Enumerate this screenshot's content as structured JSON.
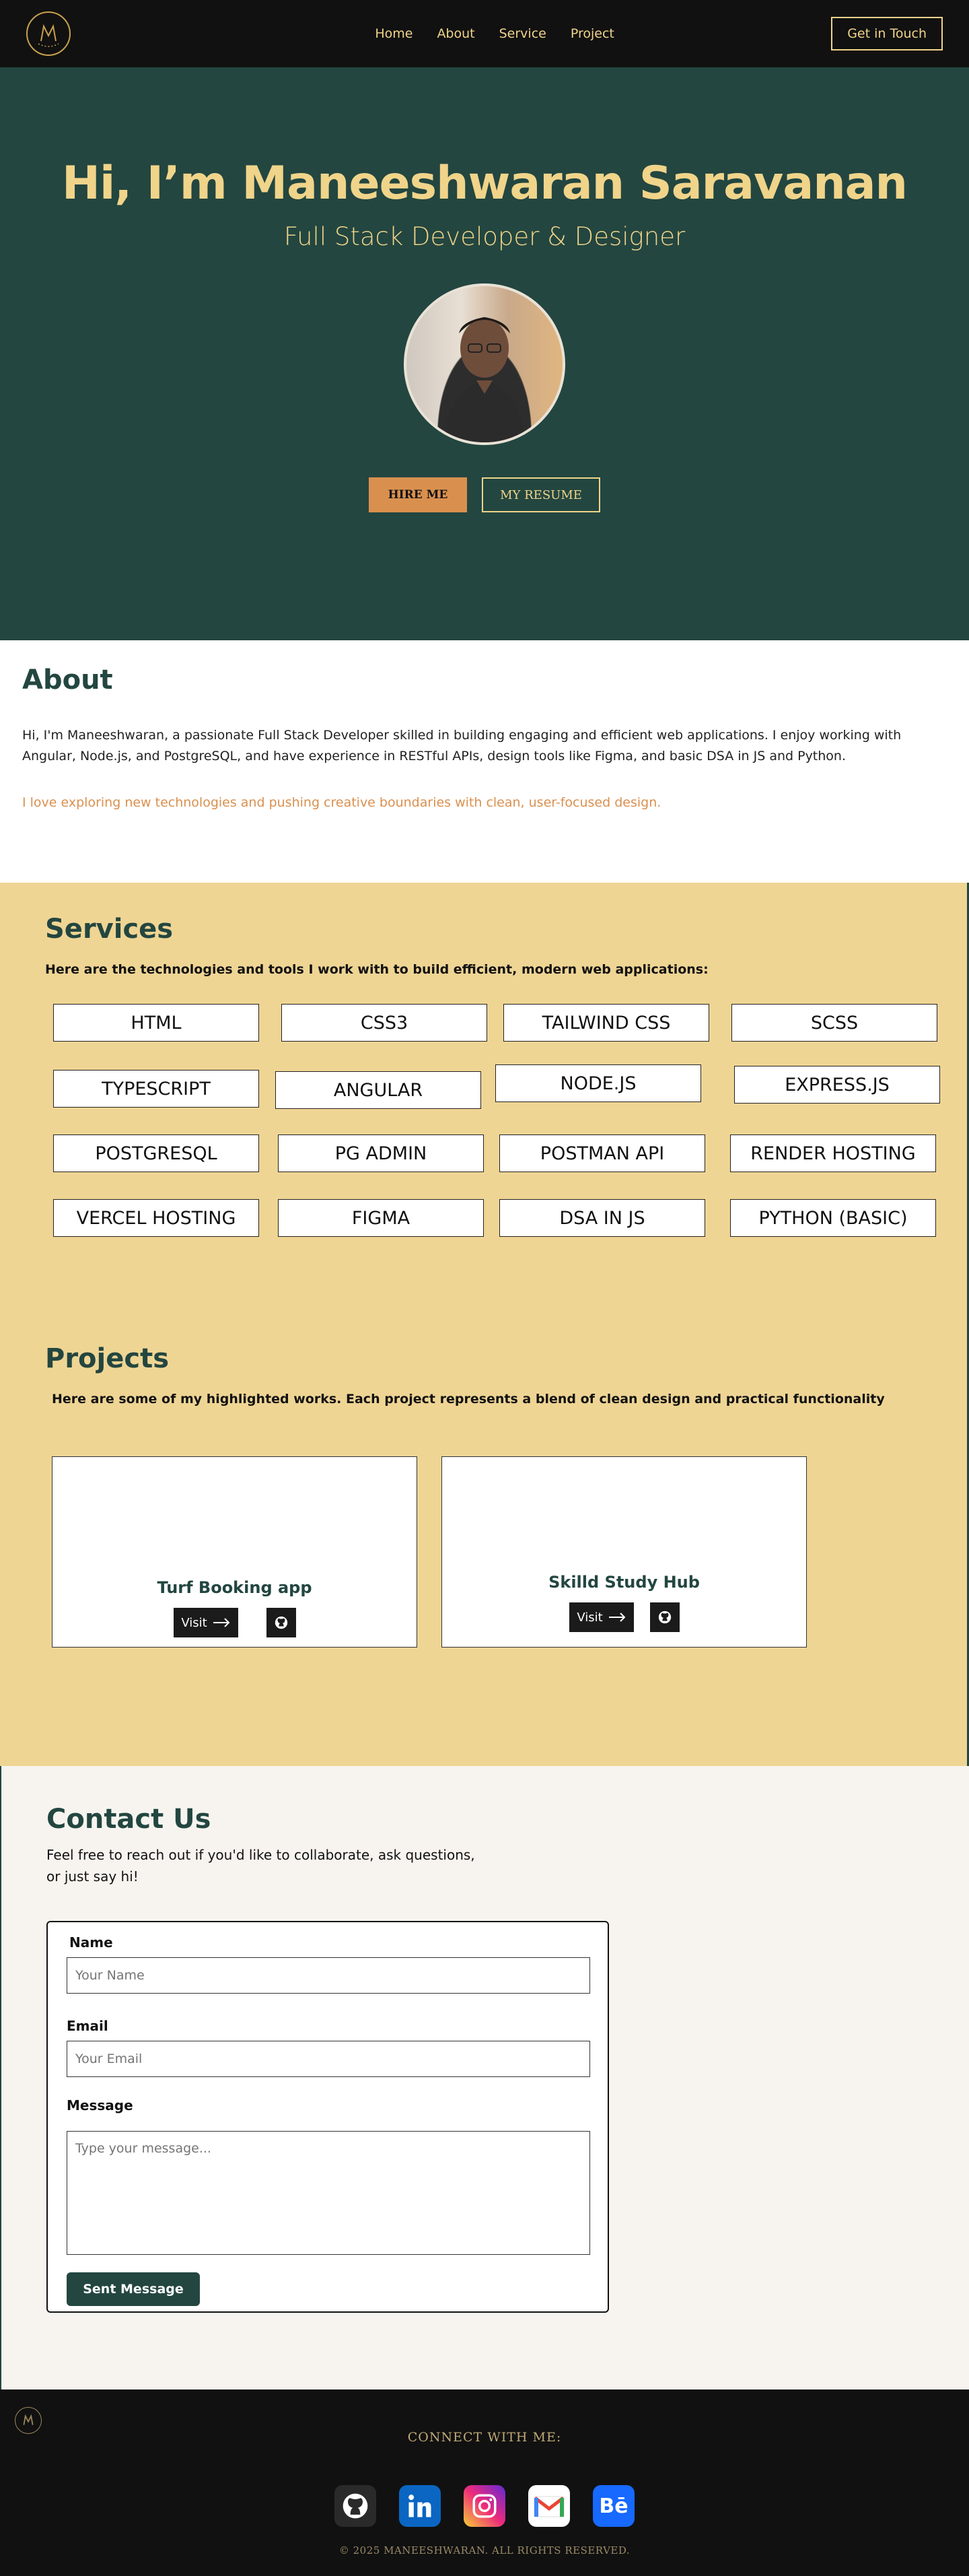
{
  "nav": {
    "links": [
      "Home",
      "About",
      "Service",
      "Project"
    ],
    "cta": "Get in Touch"
  },
  "hero": {
    "title": "Hi, I’m Maneeshwaran Saravanan",
    "subtitle": "Full Stack Developer & Designer",
    "hire_label": "HIRE ME",
    "resume_label": "MY RESUME"
  },
  "about": {
    "heading": "About",
    "body": "Hi, I'm Maneeshwaran, a passionate Full Stack Developer skilled in building engaging and efficient web applications. I enjoy working with Angular, Node.js, and PostgreSQL, and have experience in RESTful APIs, design tools like Figma, and basic DSA in JS and Python.",
    "tagline": "I love exploring new technologies and pushing creative boundaries with clean, user-focused design."
  },
  "services": {
    "heading": "Services",
    "intro": "Here are the technologies and tools I work with to build efficient, modern web applications:",
    "skills": [
      "HTML",
      "CSS3",
      "TAILWIND CSS",
      "SCSS",
      "TYPESCRIPT",
      "ANGULAR",
      "NODE.JS",
      "EXPRESS.JS",
      "POSTGRESQL",
      "PG ADMIN",
      "POSTMAN API",
      "RENDER HOSTING",
      "VERCEL HOSTING",
      "FIGMA",
      "DSA IN JS",
      "PYTHON (BASIC)"
    ]
  },
  "projects": {
    "heading": "Projects",
    "intro": "Here are some of my highlighted works. Each project represents a blend of clean design and practical functionality",
    "items": [
      {
        "title": "Turf Booking app",
        "visit": "Visit"
      },
      {
        "title": "Skilld Study Hub",
        "visit": "Visit"
      }
    ]
  },
  "contact": {
    "heading": "Contact Us",
    "lead": "Feel free to reach out if you'd like to collaborate, ask questions, or just say hi!",
    "name_label": "Name",
    "name_placeholder": "Your Name",
    "email_label": "Email",
    "email_placeholder": "Your Email",
    "message_label": "Message",
    "message_placeholder": "Type your message...",
    "submit": "Sent Message"
  },
  "footer": {
    "connect": "CONNECT WITH ME:",
    "socials": [
      "github-icon",
      "linkedin-icon",
      "instagram-icon",
      "gmail-icon",
      "behance-icon"
    ],
    "copyright": "© 2025 MANEESHWARAN. ALL RIGHTS RESERVED."
  },
  "colors": {
    "dark": "#111111",
    "green": "#234640",
    "gold": "#f0d48a",
    "orange": "#d9904f",
    "yellow": "#efd594"
  }
}
